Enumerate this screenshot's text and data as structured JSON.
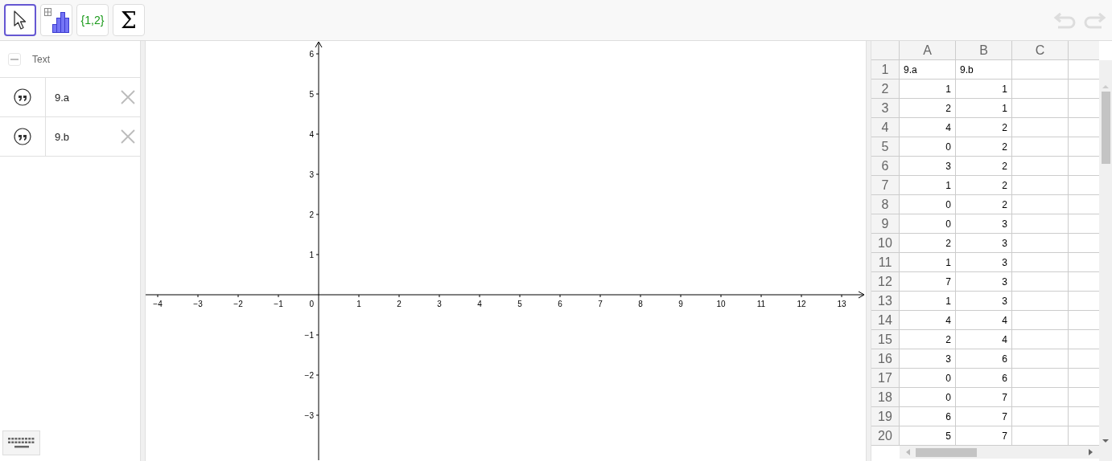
{
  "toolbar": {
    "tools": [
      {
        "kind": "pointer",
        "selected": true
      },
      {
        "kind": "chart",
        "selected": false
      },
      {
        "kind": "list",
        "label": "{1,2}",
        "selected": false
      },
      {
        "kind": "sum",
        "label": "Σ",
        "selected": false
      }
    ]
  },
  "algebra": {
    "group": {
      "label": "Text",
      "expanded": true
    },
    "items": [
      {
        "label": "9.a"
      },
      {
        "label": "9.b"
      }
    ]
  },
  "graphics": {
    "x_ticks": [
      "−4",
      "−3",
      "−2",
      "−1",
      "1",
      "2",
      "3",
      "4",
      "5",
      "6",
      "7",
      "8",
      "9",
      "10",
      "11",
      "12",
      "13"
    ],
    "y_ticks": [
      "6",
      "5",
      "4",
      "3",
      "2",
      "1",
      "−1",
      "−2",
      "−3"
    ],
    "origin_label": "0"
  },
  "spreadsheet": {
    "columns": [
      "A",
      "B",
      "C"
    ],
    "rows": [
      {
        "number": "1",
        "kind": "text",
        "cells": [
          "9.a",
          "9.b"
        ]
      },
      {
        "number": "2",
        "kind": "number",
        "cells": [
          "1",
          "1"
        ]
      },
      {
        "number": "3",
        "kind": "number",
        "cells": [
          "2",
          "1"
        ]
      },
      {
        "number": "4",
        "kind": "number",
        "cells": [
          "4",
          "2"
        ]
      },
      {
        "number": "5",
        "kind": "number",
        "cells": [
          "0",
          "2"
        ]
      },
      {
        "number": "6",
        "kind": "number",
        "cells": [
          "3",
          "2"
        ]
      },
      {
        "number": "7",
        "kind": "number",
        "cells": [
          "1",
          "2"
        ]
      },
      {
        "number": "8",
        "kind": "number",
        "cells": [
          "0",
          "2"
        ]
      },
      {
        "number": "9",
        "kind": "number",
        "cells": [
          "0",
          "3"
        ]
      },
      {
        "number": "10",
        "kind": "number",
        "cells": [
          "2",
          "3"
        ]
      },
      {
        "number": "11",
        "kind": "number",
        "cells": [
          "1",
          "3"
        ]
      },
      {
        "number": "12",
        "kind": "number",
        "cells": [
          "7",
          "3"
        ]
      },
      {
        "number": "13",
        "kind": "number",
        "cells": [
          "1",
          "3"
        ]
      },
      {
        "number": "14",
        "kind": "number",
        "cells": [
          "4",
          "4"
        ]
      },
      {
        "number": "15",
        "kind": "number",
        "cells": [
          "2",
          "4"
        ]
      },
      {
        "number": "16",
        "kind": "number",
        "cells": [
          "3",
          "6"
        ]
      },
      {
        "number": "17",
        "kind": "number",
        "cells": [
          "0",
          "6"
        ]
      },
      {
        "number": "18",
        "kind": "number",
        "cells": [
          "0",
          "7"
        ]
      },
      {
        "number": "19",
        "kind": "number",
        "cells": [
          "6",
          "7"
        ]
      },
      {
        "number": "20",
        "kind": "number",
        "cells": [
          "5",
          "7"
        ]
      }
    ]
  }
}
